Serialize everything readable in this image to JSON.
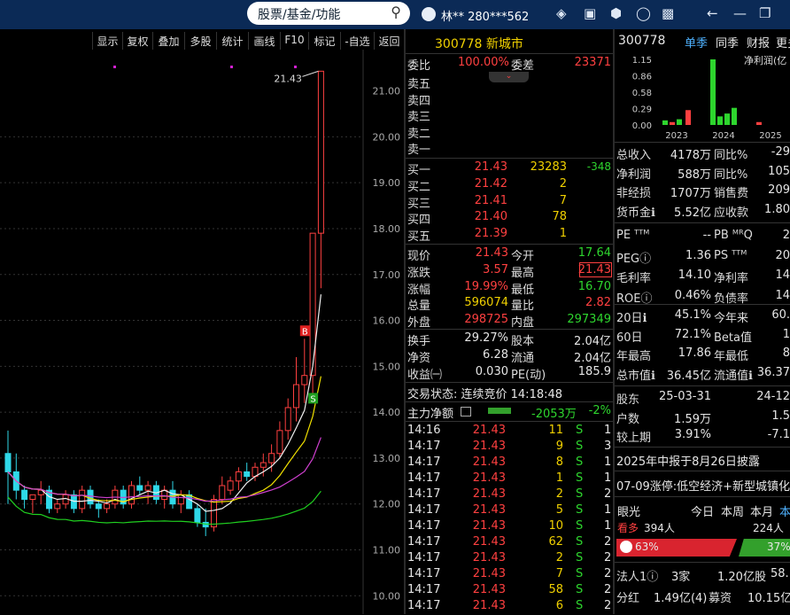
{
  "topbar": {
    "search_placeholder": "股票/基金/功能",
    "user": "林** 280***562"
  },
  "chart_toolbar": [
    "显示",
    "复权",
    "叠加",
    "多股",
    "统计",
    "画线",
    "F10",
    "标记",
    "-自选",
    "返回"
  ],
  "chart_data": {
    "type": "candlestick",
    "title": "",
    "price_axis": [
      "21.00",
      "20.00",
      "19.00",
      "18.00",
      "17.00",
      "16.00",
      "15.00",
      "14.00",
      "13.00",
      "12.00",
      "11.00",
      "10.00"
    ],
    "ylim": [
      9.6,
      21.9
    ],
    "high_label": "21.43",
    "candles": [
      {
        "o": 13.1,
        "h": 13.6,
        "l": 12.0,
        "c": 12.7
      },
      {
        "o": 12.7,
        "h": 13.1,
        "l": 12.1,
        "c": 12.3
      },
      {
        "o": 12.3,
        "h": 12.4,
        "l": 11.9,
        "c": 12.1
      },
      {
        "o": 12.1,
        "h": 12.2,
        "l": 11.8,
        "c": 12.2
      },
      {
        "o": 12.2,
        "h": 12.5,
        "l": 12.0,
        "c": 12.3
      },
      {
        "o": 12.3,
        "h": 12.4,
        "l": 11.8,
        "c": 11.9
      },
      {
        "o": 11.9,
        "h": 12.1,
        "l": 11.8,
        "c": 12.0
      },
      {
        "o": 12.0,
        "h": 12.3,
        "l": 11.9,
        "c": 12.2
      },
      {
        "o": 12.2,
        "h": 12.3,
        "l": 11.8,
        "c": 11.9
      },
      {
        "o": 11.9,
        "h": 12.4,
        "l": 11.8,
        "c": 12.3
      },
      {
        "o": 12.3,
        "h": 12.4,
        "l": 11.9,
        "c": 12.0
      },
      {
        "o": 12.0,
        "h": 12.1,
        "l": 11.7,
        "c": 11.9
      },
      {
        "o": 11.9,
        "h": 12.1,
        "l": 11.8,
        "c": 12.0
      },
      {
        "o": 12.0,
        "h": 12.4,
        "l": 11.9,
        "c": 12.3
      },
      {
        "o": 12.3,
        "h": 12.4,
        "l": 11.9,
        "c": 12.0
      },
      {
        "o": 12.0,
        "h": 12.5,
        "l": 11.9,
        "c": 12.4
      },
      {
        "o": 12.4,
        "h": 12.6,
        "l": 12.2,
        "c": 12.3
      },
      {
        "o": 12.3,
        "h": 12.5,
        "l": 12.0,
        "c": 12.4
      },
      {
        "o": 12.4,
        "h": 12.5,
        "l": 12.0,
        "c": 12.1
      },
      {
        "o": 12.1,
        "h": 12.4,
        "l": 11.9,
        "c": 12.3
      },
      {
        "o": 12.3,
        "h": 12.5,
        "l": 11.9,
        "c": 12.0
      },
      {
        "o": 12.0,
        "h": 12.3,
        "l": 11.8,
        "c": 12.2
      },
      {
        "o": 12.2,
        "h": 12.3,
        "l": 11.9,
        "c": 11.9
      },
      {
        "o": 11.9,
        "h": 12.0,
        "l": 11.5,
        "c": 11.6
      },
      {
        "o": 11.6,
        "h": 11.9,
        "l": 11.3,
        "c": 11.5
      },
      {
        "o": 11.5,
        "h": 12.2,
        "l": 11.4,
        "c": 12.1
      },
      {
        "o": 12.1,
        "h": 12.6,
        "l": 12.0,
        "c": 12.4
      },
      {
        "o": 12.3,
        "h": 12.6,
        "l": 12.2,
        "c": 12.5
      },
      {
        "o": 12.5,
        "h": 12.8,
        "l": 12.3,
        "c": 12.7
      },
      {
        "o": 12.7,
        "h": 12.9,
        "l": 12.5,
        "c": 12.6
      },
      {
        "o": 12.6,
        "h": 12.9,
        "l": 12.5,
        "c": 12.8
      },
      {
        "o": 12.8,
        "h": 13.1,
        "l": 12.6,
        "c": 12.9
      },
      {
        "o": 12.9,
        "h": 13.3,
        "l": 12.7,
        "c": 13.1
      },
      {
        "o": 13.1,
        "h": 13.8,
        "l": 13.0,
        "c": 13.6
      },
      {
        "o": 13.6,
        "h": 14.3,
        "l": 13.4,
        "c": 14.1
      },
      {
        "o": 14.1,
        "h": 15.2,
        "l": 13.8,
        "c": 14.6
      },
      {
        "o": 14.6,
        "h": 15.6,
        "l": 14.2,
        "c": 14.8
      },
      {
        "o": 14.8,
        "h": 17.9,
        "l": 14.4,
        "c": 17.9
      },
      {
        "o": 17.9,
        "h": 21.43,
        "l": 16.7,
        "c": 21.43
      }
    ],
    "signals": [
      {
        "label": "B",
        "index": 36
      },
      {
        "label": "S",
        "index": 37
      }
    ]
  },
  "quote": {
    "code_name": "300778 新城市",
    "weibi_label": "委比",
    "weibi": "100.00%",
    "weicha_label": "委差",
    "weicha": "23371",
    "sell_levels": [
      "卖五",
      "卖四",
      "卖三",
      "卖二",
      "卖一"
    ],
    "buy_levels": [
      {
        "label": "买一",
        "price": "21.43",
        "vol": "23283",
        "chg": "-348"
      },
      {
        "label": "买二",
        "price": "21.42",
        "vol": "2",
        "chg": ""
      },
      {
        "label": "买三",
        "price": "21.41",
        "vol": "7",
        "chg": ""
      },
      {
        "label": "买四",
        "price": "21.40",
        "vol": "78",
        "chg": ""
      },
      {
        "label": "买五",
        "price": "21.39",
        "vol": "1",
        "chg": ""
      }
    ],
    "stats": [
      {
        "l1": "现价",
        "v1": "21.43",
        "c1": "red",
        "l2": "今开",
        "v2": "17.64",
        "c2": "green"
      },
      {
        "l1": "涨跌",
        "v1": "3.57",
        "c1": "red",
        "l2": "最高",
        "v2": "21.43",
        "c2": "red"
      },
      {
        "l1": "涨幅",
        "v1": "19.99%",
        "c1": "red",
        "l2": "最低",
        "v2": "16.70",
        "c2": "green"
      },
      {
        "l1": "总量",
        "v1": "596074",
        "c1": "yellow",
        "l2": "量比",
        "v2": "2.82",
        "c2": "red"
      },
      {
        "l1": "外盘",
        "v1": "298725",
        "c1": "red",
        "l2": "内盘",
        "v2": "297349",
        "c2": "green"
      }
    ],
    "stats2": [
      {
        "l1": "换手",
        "v1": "29.27%",
        "l2": "股本",
        "v2": "2.04亿"
      },
      {
        "l1": "净资",
        "v1": "6.28",
        "l2": "流通",
        "v2": "2.04亿"
      },
      {
        "l1": "收益㈠",
        "v1": "0.030",
        "l2": "PE(动)",
        "v2": "185.9"
      }
    ],
    "trade_status": "交易状态: 连续竞价 14:18:48",
    "main_flow_label": "主力净额",
    "main_flow_value": "-2053万",
    "main_flow_pct": "-2%",
    "ticks": [
      {
        "t": "14:16",
        "p": "21.43",
        "v": "11",
        "s": "S",
        "n": "1"
      },
      {
        "t": "14:17",
        "p": "21.43",
        "v": "9",
        "s": "S",
        "n": "3"
      },
      {
        "t": "14:17",
        "p": "21.43",
        "v": "8",
        "s": "S",
        "n": "1"
      },
      {
        "t": "14:17",
        "p": "21.43",
        "v": "1",
        "s": "S",
        "n": "1"
      },
      {
        "t": "14:17",
        "p": "21.43",
        "v": "2",
        "s": "S",
        "n": "2"
      },
      {
        "t": "14:17",
        "p": "21.43",
        "v": "5",
        "s": "S",
        "n": "1"
      },
      {
        "t": "14:17",
        "p": "21.43",
        "v": "10",
        "s": "S",
        "n": "1"
      },
      {
        "t": "14:17",
        "p": "21.43",
        "v": "62",
        "s": "S",
        "n": "2"
      },
      {
        "t": "14:17",
        "p": "21.43",
        "v": "2",
        "s": "S",
        "n": "2"
      },
      {
        "t": "14:17",
        "p": "21.43",
        "v": "7",
        "s": "S",
        "n": "2"
      },
      {
        "t": "14:17",
        "p": "21.43",
        "v": "58",
        "s": "S",
        "n": "2"
      },
      {
        "t": "14:17",
        "p": "21.43",
        "v": "6",
        "s": "S",
        "n": "2"
      }
    ]
  },
  "fin": {
    "code": "300778",
    "tabs": [
      "单季",
      "同季",
      "财报",
      "更多"
    ],
    "mini_chart": {
      "y_ticks": [
        "1.15",
        "0.86",
        "0.58",
        "0.29",
        "0.00"
      ],
      "x_ticks": [
        "2023",
        "2024",
        "2025"
      ],
      "title": "净利润(亿",
      "bars": [
        {
          "v": 0.08,
          "color": "#2ed52e"
        },
        {
          "v": 0.05,
          "color": "#ff4040"
        },
        {
          "v": 0.1,
          "color": "#2ed52e"
        },
        {
          "v": 0.26,
          "color": "#ff4040"
        },
        {
          "v": 1.15,
          "color": "#2ed52e"
        },
        {
          "v": 0.15,
          "color": "#2ed52e"
        },
        {
          "v": 0.2,
          "color": "#2ed52e"
        },
        {
          "v": 0.3,
          "color": "#2ed52e"
        },
        {
          "v": 0.05,
          "color": "#ff4040"
        }
      ]
    },
    "rows1": [
      {
        "l1": "总收入",
        "v1": "4178万",
        "l2": "同比%",
        "v2": "-29"
      },
      {
        "l1": "净利润",
        "v1": "588万",
        "l2": "同比%",
        "v2": "105"
      },
      {
        "l1": "非经损",
        "v1": "1707万",
        "l2": "销售费",
        "v2": "209"
      },
      {
        "l1": "货币金ℹ",
        "v1": "5.52亿",
        "l2": "应收款",
        "v2": "1.80"
      }
    ],
    "rows2": [
      {
        "l1": "PE ᵀᵀᴹ",
        "v1": "--",
        "l2": "PB ᴹᴿQ",
        "v2": "2"
      },
      {
        "l1": "PEGⓘ",
        "v1": "1.36",
        "l2": "PS ᵀᵀᴹ",
        "v2": "20"
      },
      {
        "l1": "毛利率",
        "v1": "14.10",
        "l2": "净利率",
        "v2": "14"
      },
      {
        "l1": "ROEⓘ",
        "v1": "0.46%",
        "l2": "负债率",
        "v2": "14"
      }
    ],
    "rows3": [
      {
        "l1": "20日ℹ",
        "v1": "45.1%",
        "l2": "今年来",
        "v2": "60."
      },
      {
        "l1": "60日",
        "v1": "72.1%",
        "l2": "Beta值",
        "v2": "1"
      },
      {
        "l1": "年最高",
        "v1": "17.86",
        "l2": "年最低",
        "v2": "8"
      },
      {
        "l1": "总市值ℹ",
        "v1": "36.45亿",
        "l2": "流通值ℹ",
        "v2": "36.37"
      }
    ],
    "rows4": [
      {
        "l1": "股东",
        "v1": "25-03-31",
        "v2": "24-12"
      },
      {
        "l1": "户数",
        "v1": "1.59万",
        "v2": "1.5"
      },
      {
        "l1": "较上期",
        "v1": "3.91%",
        "v2": "-7.1"
      }
    ],
    "report_note": "2025年中报于8月26日披露",
    "news": "07-09涨停:低空经济+新型城镇化",
    "eye_label": "眼光",
    "eye_tabs": [
      "今日",
      "本周",
      "本月",
      "本"
    ],
    "bear_label": "看多",
    "bear_count": "394人",
    "bull_count": "224人",
    "bull_pct": "63%",
    "bear_pct": "37%",
    "inst_label": "法人1ⓘ",
    "inst_count": "3家",
    "inst_shares": "1.20亿股",
    "inst_pct": "58.",
    "div_label": "分红",
    "div_val": "1.49亿(4)",
    "raise_label": "募资",
    "raise_val": "10.15亿"
  }
}
